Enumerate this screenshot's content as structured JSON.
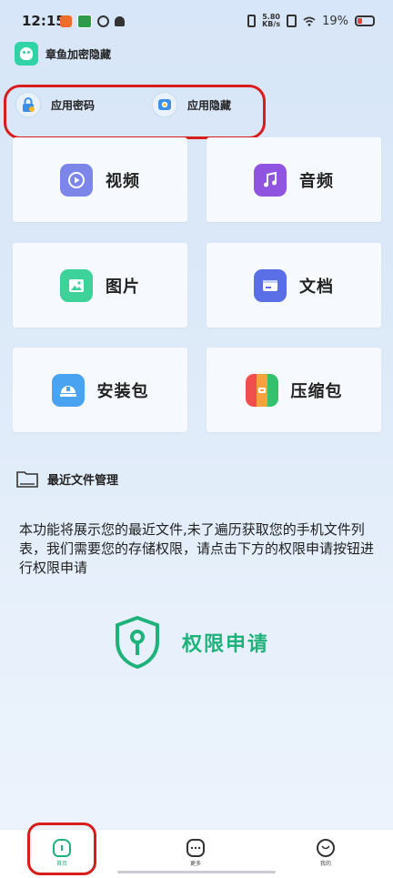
{
  "status_bar": {
    "time": "12:15",
    "network_speed_value": "5.80",
    "network_speed_unit": "KB/s",
    "battery_percent": "19%"
  },
  "app": {
    "title": "章鱼加密隐藏",
    "brand_color": "#2fd3a5"
  },
  "quick_actions": [
    {
      "label": "应用密码",
      "icon": "lock-icon"
    },
    {
      "label": "应用隐藏",
      "icon": "hide-app-icon"
    }
  ],
  "categories": [
    {
      "label": "视频",
      "icon": "video-icon",
      "color": "#7b86e8"
    },
    {
      "label": "音频",
      "icon": "music-icon",
      "color": "#8f54e0"
    },
    {
      "label": "图片",
      "icon": "image-icon",
      "color": "#3cd29a"
    },
    {
      "label": "文档",
      "icon": "document-icon",
      "color": "#5a6fe6"
    },
    {
      "label": "安装包",
      "icon": "package-icon",
      "color": "#4aa3f0"
    },
    {
      "label": "压缩包",
      "icon": "archive-icon",
      "color": "#f2a33a"
    }
  ],
  "recent": {
    "title": "最近文件管理",
    "notice": "本功能将展示您的最近文件,未了遍历获取您的手机文件列表，我们需要您的存储权限，请点击下方的权限申请按钮进行权限申请",
    "permission_button": "权限申请",
    "accent_color": "#1fb27a"
  },
  "bottom_nav": [
    {
      "label": "首页",
      "icon": "home-icon",
      "active": true
    },
    {
      "label": "更多",
      "icon": "more-icon",
      "active": false
    },
    {
      "label": "我的",
      "icon": "profile-icon",
      "active": false
    }
  ]
}
